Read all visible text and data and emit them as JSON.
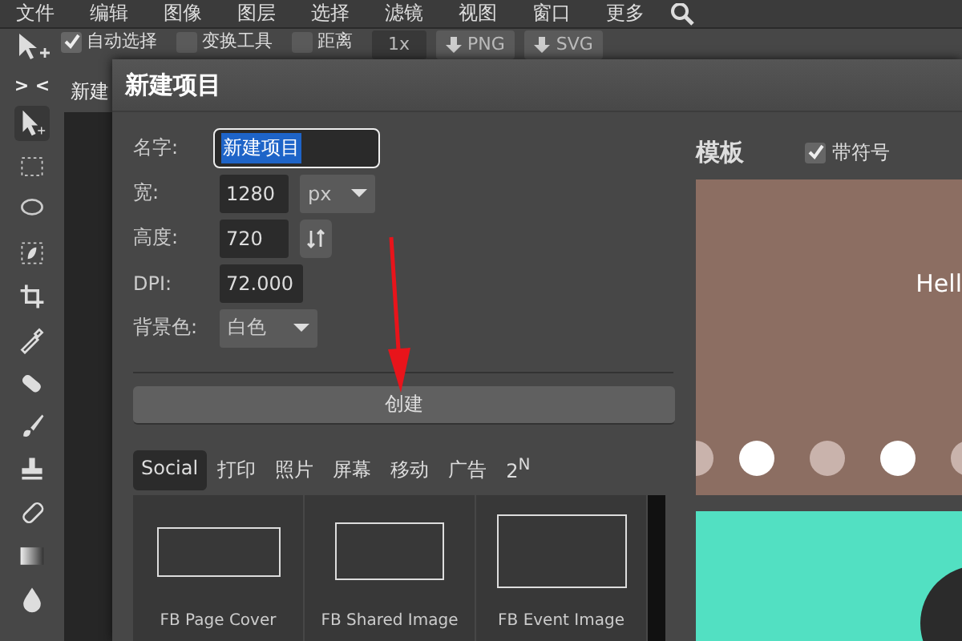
{
  "menu_bar": {
    "items": [
      "文件",
      "编辑",
      "图像",
      "图层",
      "选择",
      "滤镜",
      "视图",
      "窗口",
      "更多"
    ]
  },
  "toolbar": {
    "options": [
      {
        "label": "自动选择",
        "checked": true
      },
      {
        "label": "变换工具",
        "checked": false
      },
      {
        "label": "距离",
        "checked": false
      }
    ],
    "scale": "1x",
    "exports": [
      "PNG",
      "SVG"
    ]
  },
  "panel_toggle": "> <",
  "document_tabs": [
    {
      "label": "新建"
    }
  ],
  "dialog": {
    "title": "新建项目",
    "fields": [
      {
        "kind": "text",
        "label": "名字:",
        "value": "新建项目"
      },
      {
        "kind": "unit",
        "label": "宽:",
        "value": "1280",
        "unit": "px"
      },
      {
        "kind": "swap",
        "label": "高度:",
        "value": "720"
      },
      {
        "kind": "number",
        "label": "DPI:",
        "value": "72.000"
      },
      {
        "kind": "select",
        "label": "背景色:",
        "value": "白色"
      }
    ],
    "create_button": "创建",
    "categories": [
      {
        "label": "Social",
        "selected": true
      },
      {
        "label": "打印",
        "selected": false
      },
      {
        "label": "照片",
        "selected": false
      },
      {
        "label": "屏幕",
        "selected": false
      },
      {
        "label": "移动",
        "selected": false
      },
      {
        "label": "广告",
        "selected": false
      },
      {
        "label": "2$^{N}$",
        "selected": false
      }
    ],
    "templates": [
      {
        "name": "FB Page Cover"
      },
      {
        "name": "FB Shared Image"
      },
      {
        "name": "FB Event Image"
      }
    ],
    "template_panel": {
      "title": "模板",
      "symbols": {
        "label": "带符号",
        "checked": true
      },
      "preview_text": "Hell"
    }
  }
}
